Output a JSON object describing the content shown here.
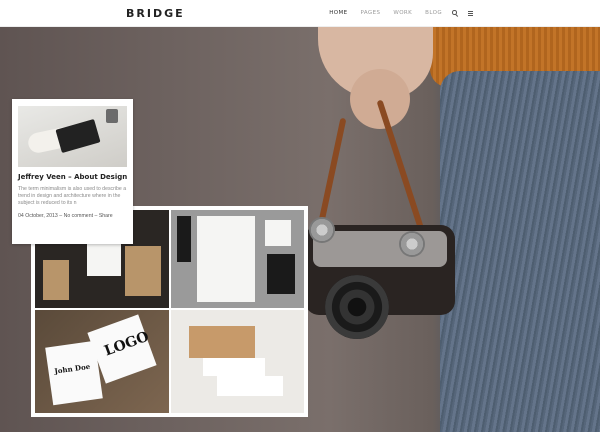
{
  "header": {
    "logo": "BRIDGE",
    "nav": [
      "HOME",
      "PAGES",
      "WORK",
      "BLOG"
    ],
    "active_index": 0,
    "icons": [
      "search-icon",
      "menu-icon"
    ]
  },
  "post": {
    "title": "Jeffrey Veen – About Design",
    "excerpt": "The term minimalism is also used to describe a trend in design and architecture where in the subject is reduced to its n",
    "date": "04 October, 2013",
    "separator": "–",
    "comments": "No comment",
    "share": "Share"
  },
  "mockup": {
    "logo_text": "LOGO",
    "name_text": "John Doe"
  },
  "colors": {
    "header_bg": "#ffffff",
    "nav_active": "#333333",
    "nav_inactive": "#9a9a9a",
    "hero_bg": "#6e6360",
    "sweater": "#c27428",
    "jeans": "#5b6876"
  }
}
